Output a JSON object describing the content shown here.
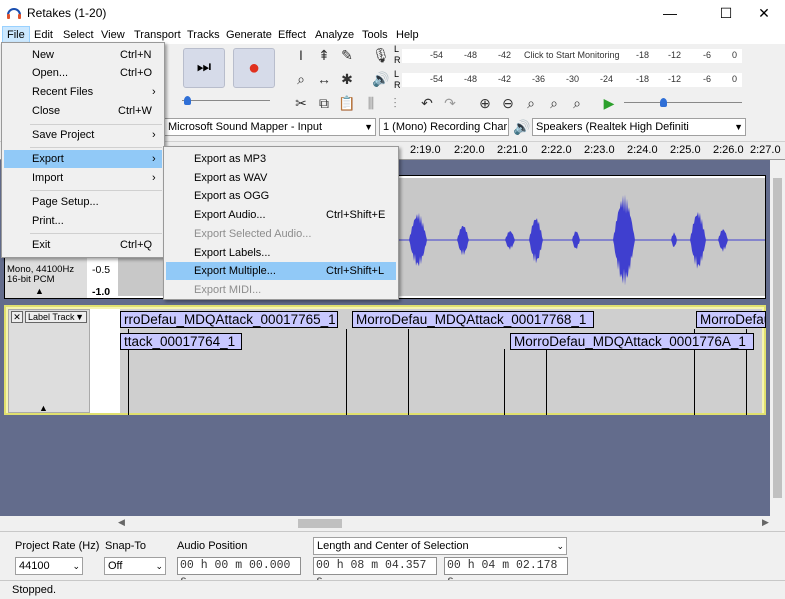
{
  "window": {
    "title": "Retakes (1-20)",
    "controls": [
      "—",
      "☐",
      "✕"
    ]
  },
  "menubar": [
    "File",
    "Edit",
    "Select",
    "View",
    "Transport",
    "Tracks",
    "Generate",
    "Effect",
    "Analyze",
    "Tools",
    "Help"
  ],
  "file_menu": [
    {
      "label": "New",
      "shortcut": "Ctrl+N"
    },
    {
      "label": "Open...",
      "shortcut": "Ctrl+O"
    },
    {
      "label": "Recent Files",
      "shortcut": "›"
    },
    {
      "label": "Close",
      "shortcut": "Ctrl+W"
    },
    {
      "label": "Save Project",
      "shortcut": "›"
    },
    {
      "label": "Export",
      "shortcut": "›"
    },
    {
      "label": "Import",
      "shortcut": "›"
    },
    {
      "label": "Page Setup...",
      "shortcut": ""
    },
    {
      "label": "Print...",
      "shortcut": ""
    },
    {
      "label": "Exit",
      "shortcut": "Ctrl+Q"
    }
  ],
  "export_menu": [
    {
      "label": "Export as MP3",
      "shortcut": ""
    },
    {
      "label": "Export as WAV",
      "shortcut": ""
    },
    {
      "label": "Export as OGG",
      "shortcut": ""
    },
    {
      "label": "Export Audio...",
      "shortcut": "Ctrl+Shift+E"
    },
    {
      "label": "Export Selected Audio...",
      "shortcut": ""
    },
    {
      "label": "Export Labels...",
      "shortcut": ""
    },
    {
      "label": "Export Multiple...",
      "shortcut": "Ctrl+Shift+L"
    },
    {
      "label": "Export MIDI...",
      "shortcut": ""
    }
  ],
  "meters": {
    "record_ticks": [
      "-54",
      "-48",
      "-42",
      "Click to Start Monitoring",
      "-18",
      "-12",
      "-6",
      "0"
    ],
    "play_ticks": [
      "-54",
      "-48",
      "-42",
      "-36",
      "-30",
      "-24",
      "-18",
      "-12",
      "-6",
      "0"
    ],
    "channel_l": "L",
    "channel_r": "R"
  },
  "devices": {
    "input": "Microsoft Sound Mapper - Input",
    "channels": "1 (Mono) Recording Char",
    "output": "Speakers (Realtek High Definiti"
  },
  "ruler_ticks": [
    "2:19.0",
    "2:20.0",
    "2:21.0",
    "2:22.0",
    "2:23.0",
    "2:24.0",
    "2:25.0",
    "2:26.0",
    "2:27.0"
  ],
  "audio_track": {
    "info_line1": "Mono, 44100Hz",
    "info_line2": "16-bit PCM",
    "scale_mid": "-0.5",
    "scale_bottom": "-1.0"
  },
  "label_track": {
    "name": "Label Track",
    "labels": [
      "rroDefau_MDQAttack_00017765_1",
      "MorroDefau_MDQAttack_00017768_1",
      "MorroDefau",
      "ttack_00017764_1",
      "MorroDefau_MDQAttack_0001776A_1"
    ]
  },
  "selection_toolbar": {
    "project_rate_label": "Project Rate (Hz)",
    "project_rate": "44100",
    "snap_to_label": "Snap-To",
    "snap_to": "Off",
    "audio_position_label": "Audio Position",
    "audio_position": "00 h 00 m 00.000 s",
    "selection_mode": "Length and Center of Selection",
    "length": "00 h 08 m 04.357 s",
    "center": "00 h 04 m 02.178 s"
  },
  "status": "Stopped.",
  "colors": {
    "menu_highlight": "#91c9f7",
    "label_fill": "#c8c8ff",
    "waveform": "#3f3fcf",
    "track_bg": "#636c8c"
  }
}
